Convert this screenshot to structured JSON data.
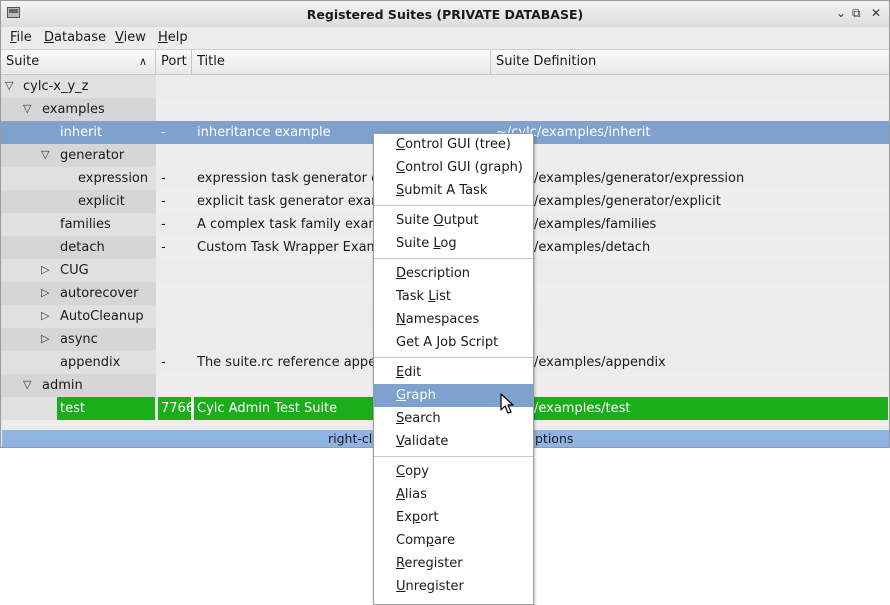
{
  "window": {
    "title": "Registered Suites (PRIVATE DATABASE)",
    "controls": [
      "⌄",
      "⧉",
      "✕"
    ]
  },
  "menubar": [
    {
      "label": "File",
      "mnemonic": "F",
      "rest": "ile"
    },
    {
      "label": "Database",
      "mnemonic": "D",
      "rest": "atabase"
    },
    {
      "label": "View",
      "mnemonic": "V",
      "rest": "iew"
    },
    {
      "label": "Help",
      "mnemonic": "H",
      "rest": "elp"
    }
  ],
  "columns": {
    "suite": "Suite",
    "port": "Port",
    "title": "Title",
    "definition": "Suite Definition",
    "sort_icon": "chevron-up-icon"
  },
  "rows": [
    {
      "name": "cylc-x_y_z",
      "expander": "▽",
      "port": "",
      "title": "",
      "definition": ""
    },
    {
      "name": "examples",
      "expander": "▽",
      "port": "",
      "title": "",
      "definition": ""
    },
    {
      "name": "inherit",
      "expander": "",
      "port": "-",
      "title": "inheritance example",
      "definition": "~/cylc/examples/inherit"
    },
    {
      "name": "generator",
      "expander": "▽",
      "port": "",
      "title": "",
      "definition": ""
    },
    {
      "name": "expression",
      "expander": "",
      "port": "-",
      "title": "expression task generator example",
      "definition": "~/cylc/examples/generator/expression"
    },
    {
      "name": "explicit",
      "expander": "",
      "port": "-",
      "title": "explicit task generator example",
      "definition": "~/cylc/examples/generator/explicit"
    },
    {
      "name": "families",
      "expander": "",
      "port": "-",
      "title": "A complex task family example",
      "definition": "~/cylc/examples/families"
    },
    {
      "name": "detach",
      "expander": "",
      "port": "-",
      "title": "Custom Task Wrapper Example",
      "definition": "~/cylc/examples/detach"
    },
    {
      "name": "CUG",
      "expander": "▷",
      "port": "",
      "title": "",
      "definition": ""
    },
    {
      "name": "autorecover",
      "expander": "▷",
      "port": "",
      "title": "",
      "definition": ""
    },
    {
      "name": "AutoCleanup",
      "expander": "▷",
      "port": "",
      "title": "",
      "definition": ""
    },
    {
      "name": "async",
      "expander": "▷",
      "port": "",
      "title": "",
      "definition": ""
    },
    {
      "name": "appendix",
      "expander": "",
      "port": "-",
      "title": "The suite.rc reference appendix",
      "definition": "~/cylc/examples/appendix"
    },
    {
      "name": "admin",
      "expander": "▽",
      "port": "",
      "title": "",
      "definition": ""
    },
    {
      "name": "test",
      "expander": "",
      "port": "7766",
      "title": "Cylc Admin Test Suite",
      "definition": "~/cylc/examples/test"
    }
  ],
  "visible_fragments": {
    "inherit_def": "~/cylc/examples/inherit",
    "expression_def": "/examples/generator/expression",
    "explicit_def": "/examples/generator/explicit",
    "families_def": "/examples/families",
    "detach_def": "/examples/detach",
    "appendix_def": "/examples/appendix",
    "test_def": "/examples/test",
    "expression_title": "expression task generator exa",
    "explicit_title": "explicit task generator example",
    "families_title": "A complex task family exampl",
    "detach_title": "Custom Task Wrapper Examp",
    "appendix_title": "The suite.rc reference appendi"
  },
  "status": {
    "left": "right-clic",
    "right": "ptions"
  },
  "context_menu": [
    {
      "pre": "",
      "u": "C",
      "post": "ontrol GUI (tree)"
    },
    {
      "pre": "",
      "u": "C",
      "post": "ontrol GUI (graph)"
    },
    {
      "pre": "",
      "u": "S",
      "post": "ubmit A Task"
    },
    {
      "sep": true
    },
    {
      "pre": "Suite ",
      "u": "O",
      "post": "utput"
    },
    {
      "pre": "Suite ",
      "u": "L",
      "post": "og"
    },
    {
      "sep": true
    },
    {
      "pre": "",
      "u": "D",
      "post": "escription"
    },
    {
      "pre": "Task ",
      "u": "L",
      "post": "ist"
    },
    {
      "pre": "",
      "u": "N",
      "post": "amespaces"
    },
    {
      "pre": "Get A ",
      "u": "J",
      "post": "ob Script"
    },
    {
      "sep": true
    },
    {
      "pre": "",
      "u": "E",
      "post": "dit"
    },
    {
      "pre": "",
      "u": "G",
      "post": "raph",
      "highlight": true
    },
    {
      "pre": "",
      "u": "S",
      "post": "earch"
    },
    {
      "pre": "",
      "u": "V",
      "post": "alidate"
    },
    {
      "sep": true
    },
    {
      "pre": "",
      "u": "C",
      "post": "opy"
    },
    {
      "pre": "",
      "u": "A",
      "post": "lias"
    },
    {
      "pre": "Ex",
      "u": "p",
      "post": "ort"
    },
    {
      "pre": "Com",
      "u": "p",
      "post": "are"
    },
    {
      "pre": "",
      "u": "R",
      "post": "eregister"
    },
    {
      "pre": "",
      "u": "U",
      "post": "nregister"
    }
  ]
}
